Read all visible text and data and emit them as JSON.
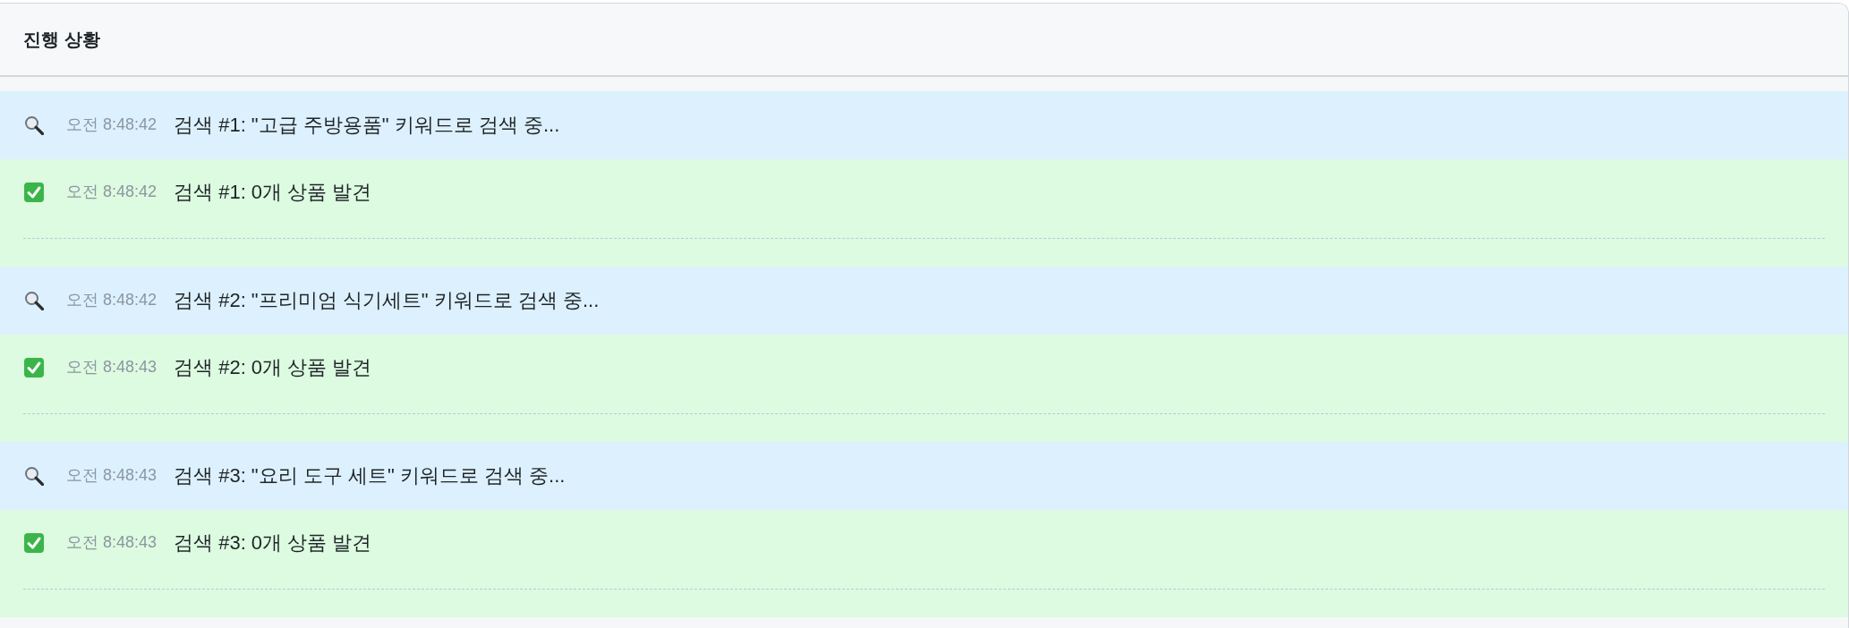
{
  "panel": {
    "title": "진행 상황"
  },
  "log": [
    {
      "kind": "search",
      "time": "오전 8:48:42",
      "message": "검색 #1: \"고급 주방용품\" 키워드로 검색 중..."
    },
    {
      "kind": "result",
      "time": "오전 8:48:42",
      "message": "검색 #1: 0개 상품 발견"
    },
    {
      "kind": "search",
      "time": "오전 8:48:42",
      "message": "검색 #2: \"프리미엄 식기세트\" 키워드로 검색 중..."
    },
    {
      "kind": "result",
      "time": "오전 8:48:43",
      "message": "검색 #2: 0개 상품 발견"
    },
    {
      "kind": "search",
      "time": "오전 8:48:43",
      "message": "검색 #3: \"요리 도구 세트\" 키워드로 검색 중..."
    },
    {
      "kind": "result",
      "time": "오전 8:48:43",
      "message": "검색 #3: 0개 상품 발견"
    }
  ]
}
